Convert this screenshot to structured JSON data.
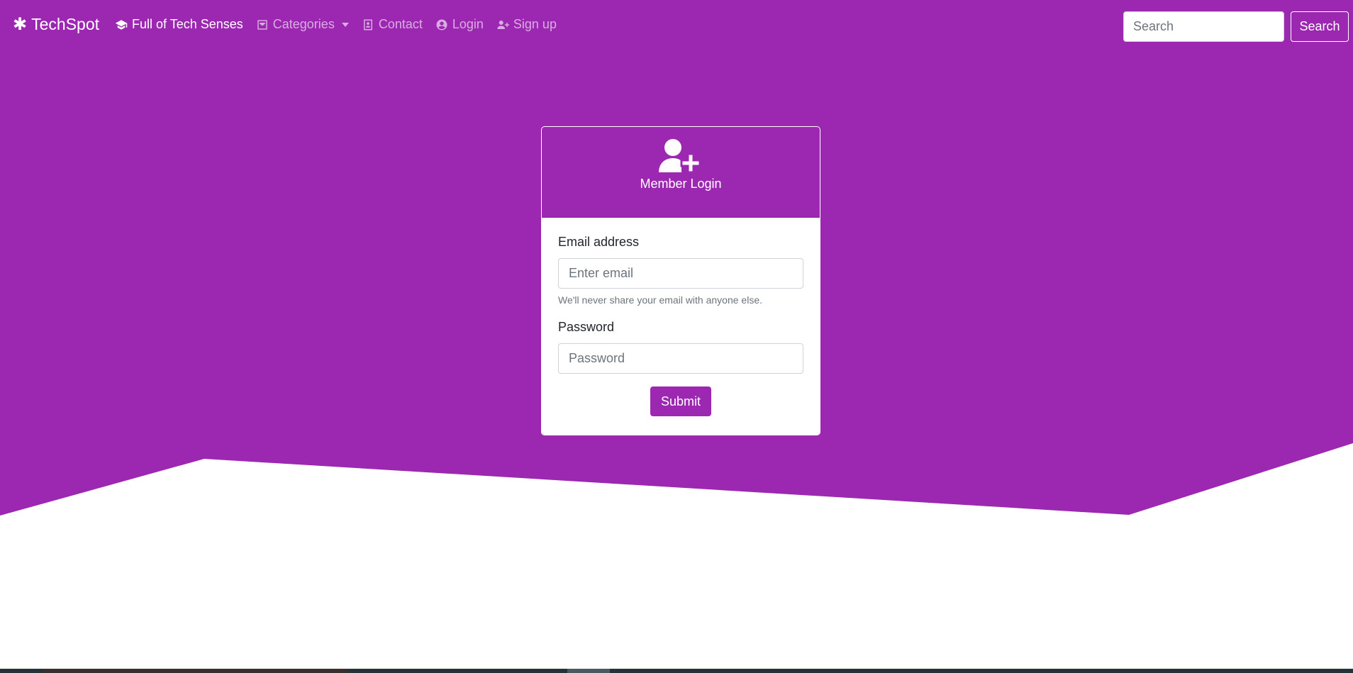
{
  "colors": {
    "primary": "#9c27b0",
    "white": "#ffffff"
  },
  "nav": {
    "brand": {
      "label": "TechSpot",
      "icon": "asterisk-icon"
    },
    "items": [
      {
        "label": "Full of Tech Senses",
        "icon": "graduation-cap-icon",
        "active": true
      },
      {
        "label": "Categories",
        "icon": "inbox-icon",
        "dropdown": true
      },
      {
        "label": "Contact",
        "icon": "contact-book-icon"
      },
      {
        "label": "Login",
        "icon": "user-circle-icon"
      },
      {
        "label": "Sign up",
        "icon": "user-plus-icon"
      }
    ],
    "search": {
      "placeholder": "Search",
      "button_label": "Search"
    }
  },
  "login_card": {
    "icon": "user-plus-icon",
    "title": "Member Login",
    "email": {
      "label": "Email address",
      "placeholder": "Enter email",
      "help": "We'll never share your email with anyone else."
    },
    "password": {
      "label": "Password",
      "placeholder": "Password"
    },
    "submit_label": "Submit"
  }
}
